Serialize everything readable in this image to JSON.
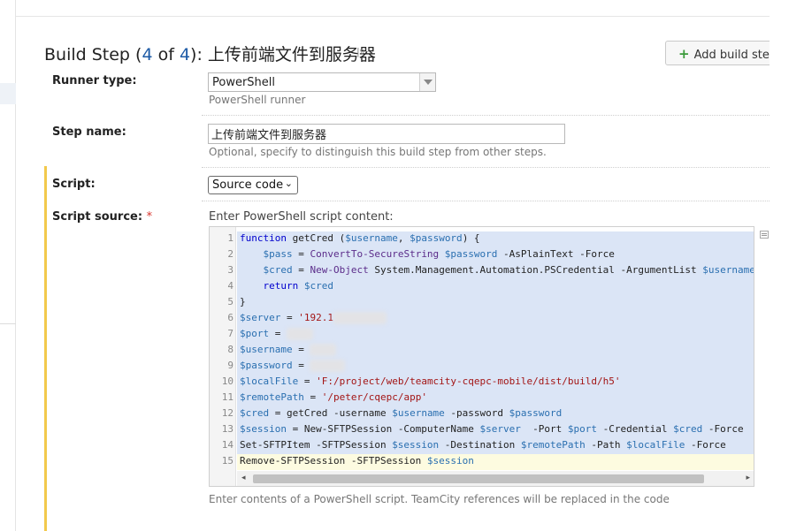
{
  "page": {
    "title_prefix": "Build Step (",
    "step_current": "4",
    "title_of": " of ",
    "step_total": "4",
    "title_suffix": "): 上传前端文件到服务器",
    "title_menu_icon": "|▿",
    "add_build_step_label": "Add build step"
  },
  "runner": {
    "label": "Runner type:",
    "value": "PowerShell",
    "hint": "PowerShell runner"
  },
  "step_name": {
    "label": "Step name:",
    "value": "上传前端文件到服务器",
    "hint": "Optional, specify to distinguish this build step from other steps."
  },
  "script": {
    "label": "Script:",
    "value": "Source code"
  },
  "script_source": {
    "label": "Script source:",
    "required_mark": "*",
    "prompt": "Enter PowerShell script content:",
    "footer_hint": "Enter contents of a PowerShell script. TeamCity references will be replaced in the code"
  },
  "code": {
    "line_numbers": [
      "1",
      "2",
      "3",
      "4",
      "5",
      "6",
      "7",
      "8",
      "9",
      "10",
      "11",
      "12",
      "13",
      "14",
      "15"
    ],
    "l1a": "function",
    "l1b": " getCred (",
    "l1c": "$username",
    "l1d": ", ",
    "l1e": "$password",
    "l1f": ") {",
    "l2a": "    $pass",
    "l2b": " = ",
    "l2c": "ConvertTo-SecureString",
    "l2d": " $password",
    "l2e": " -AsPlainText -Force",
    "l3a": "    $cred",
    "l3b": " = ",
    "l3c": "New-Object",
    "l3d": " System.Management.Automation.PSCredential -ArgumentList ",
    "l3e": "$username",
    "l4a": "    return",
    "l4b": " $cred",
    "l5": "}",
    "l6a": "$server",
    "l6b": " = ",
    "l6c": "'192.1",
    "l7a": "$port",
    "l7b": " = ",
    "l8a": "$username",
    "l8b": " = ",
    "l9a": "$password",
    "l9b": " = ",
    "l10a": "$localFile",
    "l10b": " = ",
    "l10c": "'F:/project/web/teamcity-cqepc-mobile/dist/build/h5'",
    "l11a": "$remotePath",
    "l11b": " = ",
    "l11c": "'/peter/cqepc/app'",
    "l12a": "$cred",
    "l12b": " = getCred -username ",
    "l12c": "$username",
    "l12d": " -password ",
    "l12e": "$password",
    "l13a": "$session",
    "l13b": " = New-SFTPSession -ComputerName ",
    "l13c": "$server",
    "l13d": "  -Port ",
    "l13e": "$port",
    "l13f": " -Credential ",
    "l13g": "$cred",
    "l13h": " -Force",
    "l14a": "Set-SFTPItem -SFTPSession ",
    "l14b": "$session",
    "l14c": " -Destination ",
    "l14d": "$remotePath",
    "l14e": " -Path ",
    "l14f": "$localFile",
    "l14g": " -Force",
    "l15a": "Remove-SFTPSession -SFTPSession ",
    "l15b": "$session"
  },
  "scrollbar": {
    "left_arrow": "◂",
    "right_arrow": "▸"
  },
  "icons": [
    "plus-icon",
    "dropdown-arrow-icon",
    "chevron-down-icon",
    "editor-options-icon"
  ],
  "colors": {
    "accent_blue": "#1c5aa6",
    "add_green": "#3a9a3a",
    "required_red": "#d8342c",
    "section_bar": "#f2c94c",
    "selection": "#dbe5f6"
  }
}
